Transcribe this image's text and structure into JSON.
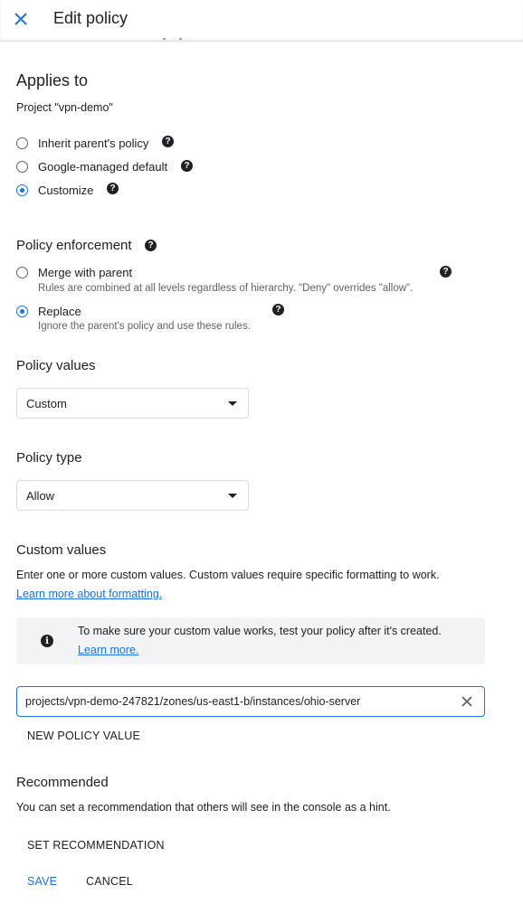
{
  "header": {
    "title": "Edit policy",
    "close_icon": "close-icon"
  },
  "applies_to": {
    "heading": "Applies to",
    "project": "Project \"vpn-demo\"",
    "options": [
      {
        "label": "Inherit parent's policy",
        "checked": false
      },
      {
        "label": "Google-managed default",
        "checked": false
      },
      {
        "label": "Customize",
        "checked": true
      }
    ]
  },
  "enforcement": {
    "heading": "Policy enforcement",
    "options": [
      {
        "label": "Merge with parent",
        "description": "Rules are combined at all levels regardless of hierarchy. \"Deny\" overrides \"allow\".",
        "checked": false
      },
      {
        "label": "Replace",
        "description": "Ignore the parent's policy and use these rules.",
        "checked": true
      }
    ]
  },
  "policy_values": {
    "heading": "Policy values",
    "selected": "Custom"
  },
  "policy_type": {
    "heading": "Policy type",
    "selected": "Allow"
  },
  "custom_values": {
    "heading": "Custom values",
    "description": "Enter one or more custom values. Custom values require specific formatting to work.",
    "learn_link": "Learn more about formatting.",
    "banner_text": "To make sure your custom value works, test your policy after it's created.",
    "banner_link": "Learn more.",
    "input_value": "projects/vpn-demo-247821/zones/us-east1-b/instances/ohio-server",
    "new_value_button": "NEW POLICY VALUE"
  },
  "recommended": {
    "heading": "Recommended",
    "description": "You can set a recommendation that others will see in the console as a hint.",
    "set_button": "SET RECOMMENDATION"
  },
  "actions": {
    "save": "SAVE",
    "cancel": "CANCEL"
  },
  "colors": {
    "accent": "#1a73e8",
    "text": "#202124",
    "secondary": "#5f6368",
    "banner_bg": "#f1f3f4"
  }
}
